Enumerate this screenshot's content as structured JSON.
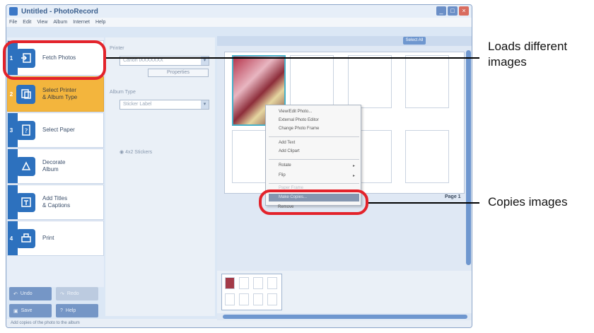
{
  "window": {
    "title": "Untitled - PhotoRecord"
  },
  "menubar": [
    "File",
    "Edit",
    "View",
    "Album",
    "Internet",
    "Help"
  ],
  "steps": [
    {
      "number": "1",
      "label": "Fetch Photos",
      "icon": "fetch-photo-icon"
    },
    {
      "number": "2",
      "label": "Select Printer\n& Album Type",
      "icon": "printer-icon"
    },
    {
      "number": "3",
      "label": "Select Paper",
      "icon": "paper-icon"
    },
    {
      "number": "",
      "label": "Decorate\nAlbum",
      "icon": "decorate-icon"
    },
    {
      "number": "",
      "label": "Add Titles\n& Captions",
      "icon": "titles-icon"
    },
    {
      "number": "4",
      "label": "Print",
      "icon": "print-icon"
    }
  ],
  "bottom_buttons": {
    "undo": "Undo",
    "redo": "Redo",
    "save": "Save",
    "help": "Help"
  },
  "status_text": "Add copies of the photo to the album",
  "options": {
    "printer_label": "Printer",
    "printer_value": "Canon iXXXXXXX",
    "properties_button": "Properties",
    "album_type_label": "Album Type",
    "album_type_value": "Sticker Label",
    "stickers_option": "4x2 Stickers"
  },
  "toolbar": {
    "select_all": "Select All"
  },
  "page_label": "Page 1",
  "context_menu": {
    "items": [
      {
        "label": "View/Edit Photo...",
        "submenu": false
      },
      {
        "label": "External Photo Editor",
        "submenu": false
      },
      {
        "label": "Change Photo Frame",
        "submenu": false
      },
      {
        "label": "Add Text",
        "submenu": false
      },
      {
        "label": "Add Clipart",
        "submenu": false
      },
      {
        "label": "Rotate",
        "submenu": true
      },
      {
        "label": "Flip",
        "submenu": true
      },
      {
        "label": "Paper Frame",
        "submenu": false
      },
      {
        "label": "Make Copies...",
        "submenu": false
      },
      {
        "label": "Remove",
        "submenu": false
      }
    ]
  },
  "callouts": {
    "top": "Loads different\nimages",
    "bottom": "Copies images"
  },
  "colors": {
    "accent": "#2d71be",
    "active_step": "#f3b53d",
    "callout_red": "#e3232b"
  }
}
